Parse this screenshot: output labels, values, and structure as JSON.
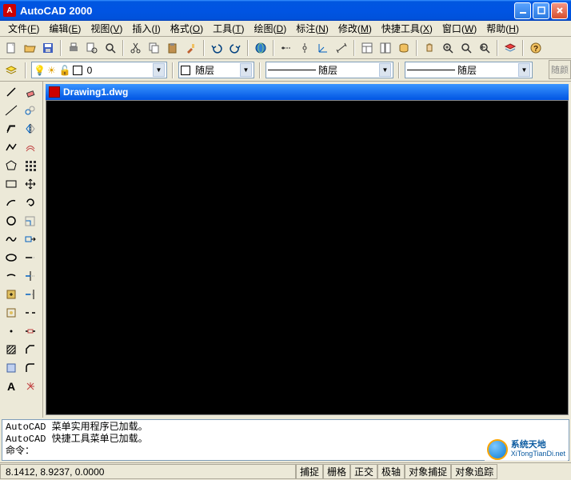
{
  "title": "AutoCAD 2000",
  "menu": [
    {
      "label": "文件",
      "key": "F"
    },
    {
      "label": "编辑",
      "key": "E"
    },
    {
      "label": "视图",
      "key": "V"
    },
    {
      "label": "插入",
      "key": "I"
    },
    {
      "label": "格式",
      "key": "O"
    },
    {
      "label": "工具",
      "key": "T"
    },
    {
      "label": "绘图",
      "key": "D"
    },
    {
      "label": "标注",
      "key": "N"
    },
    {
      "label": "修改",
      "key": "M"
    },
    {
      "label": "快捷工具",
      "key": "X"
    },
    {
      "label": "窗口",
      "key": "W"
    },
    {
      "label": "帮助",
      "key": "H"
    }
  ],
  "layer_combo": "0",
  "color_combo": "随层",
  "linetype_combo": "随层",
  "lineweight_combo": "随层",
  "side_button": "随颜",
  "document_title": "Drawing1.dwg",
  "command_lines": [
    "AutoCAD 菜单实用程序已加载。",
    "AutoCAD 快捷工具菜单已加载。",
    "命令："
  ],
  "coords": "8.1412, 8.9237, 0.0000",
  "status_buttons": [
    "捕捉",
    "栅格",
    "正交",
    "极轴",
    "对象捕捉",
    "对象追踪"
  ],
  "watermark": {
    "main": "系统天地",
    "sub": "XiTongTianDi.net"
  }
}
